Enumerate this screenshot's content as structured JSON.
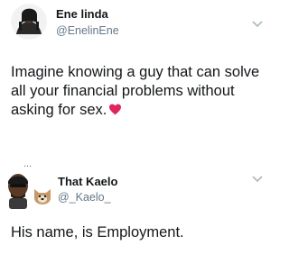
{
  "tweets": [
    {
      "name": "Ene linda",
      "handle": "@EnelinEne",
      "text": "Imagine knowing a guy that can solve all your financial problems without asking for sex.",
      "icons": {
        "avatar": "avatar-photo",
        "emoji": "heart-icon",
        "menu": "chevron-down-icon"
      }
    },
    {
      "name": "That Kaelo",
      "handle": "@_Kaelo_",
      "text": "His name, is Employment.",
      "icons": {
        "avatar": "avatar-photo",
        "emoji": "dog-emoji-icon",
        "menu": "chevron-down-icon"
      }
    }
  ],
  "separator": "...",
  "colors": {
    "text": "#14171a",
    "secondary": "#657786",
    "heart": "#e0245e",
    "chevron": "#aab8c2"
  }
}
